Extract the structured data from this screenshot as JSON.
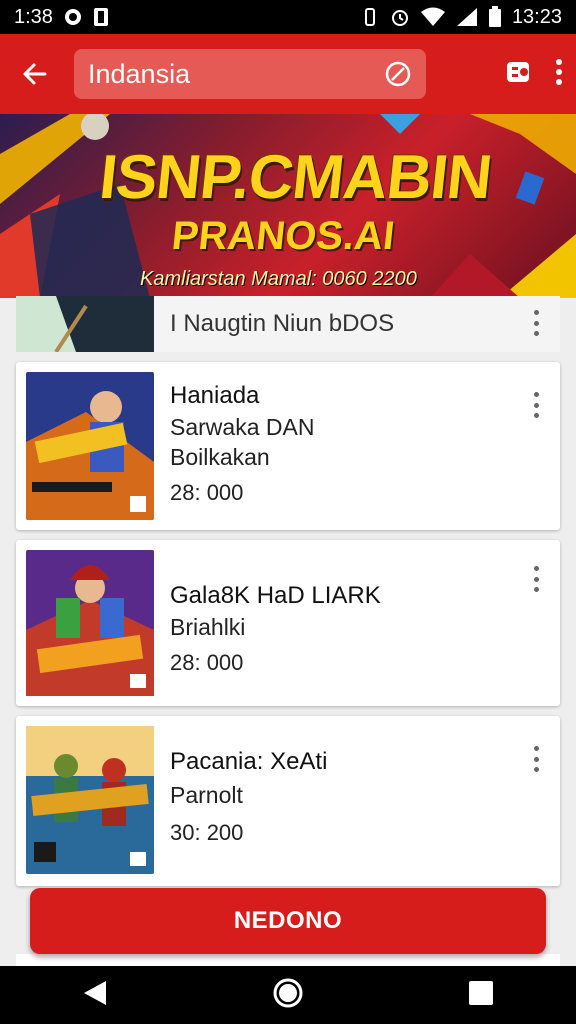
{
  "status_bar": {
    "time_left": "1:38",
    "time_right": "13:23"
  },
  "app_bar": {
    "search_value": "Indansia",
    "icons": [
      "back-arrow-icon",
      "clear-icon",
      "share-icon",
      "more-vert-icon"
    ]
  },
  "banner": {
    "title": "ISNP.CMABIN",
    "subtitle": "PRANOS.AI",
    "caption": "Kamliarstan Mamal: 0060 2200"
  },
  "items": [
    {
      "title": "I Naugtin Niun bDOS"
    },
    {
      "title": "Haniada",
      "subtitle_lines": [
        "Sarwaka DAN",
        "Boilkakan"
      ],
      "price": "28: 000",
      "thumb_colors": [
        "#2a3a8a",
        "#d46a1a"
      ]
    },
    {
      "title": "Gala8K HaD LIARK",
      "subtitle_lines": [
        "Briahlki"
      ],
      "price": "28: 000",
      "thumb_colors": [
        "#5a2a8a",
        "#c23a2a"
      ]
    },
    {
      "title": "Pacania: XeAti",
      "subtitle_lines": [
        "Parnolt"
      ],
      "price": "30: 200",
      "thumb_colors": [
        "#2a6a9a",
        "#e0a020"
      ]
    }
  ],
  "cta": {
    "label": "NEDONO"
  },
  "colors": {
    "primary": "#d71c1c",
    "gold": "#ffd21c"
  }
}
